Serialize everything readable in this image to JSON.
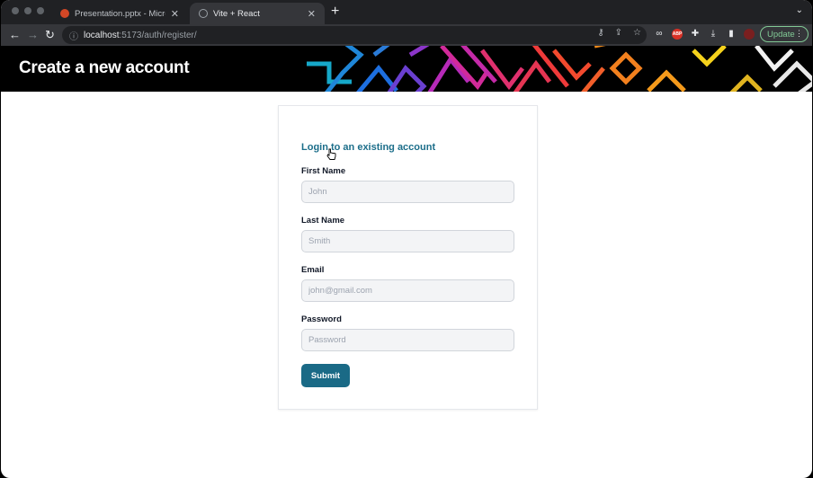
{
  "browser": {
    "tabs": [
      {
        "label": "Presentation.pptx - Microsoft P",
        "active": false,
        "favicon_color": "#d24726"
      },
      {
        "label": "Vite + React",
        "active": true,
        "favicon_color": "#9aa0a6"
      }
    ],
    "url_host": "localhost",
    "url_path": ":5173/auth/register/",
    "update_label": "Update",
    "abp_label": "ABP"
  },
  "header": {
    "title": "Create a new account"
  },
  "form": {
    "login_link": "Login to an existing account",
    "fields": [
      {
        "label": "First Name",
        "placeholder": "John"
      },
      {
        "label": "Last Name",
        "placeholder": "Smith"
      },
      {
        "label": "Email",
        "placeholder": "john@gmail.com"
      },
      {
        "label": "Password",
        "placeholder": "Password"
      }
    ],
    "submit_label": "Submit"
  },
  "colors": {
    "accent": "#1a6a86",
    "link": "#1c6e8a"
  }
}
